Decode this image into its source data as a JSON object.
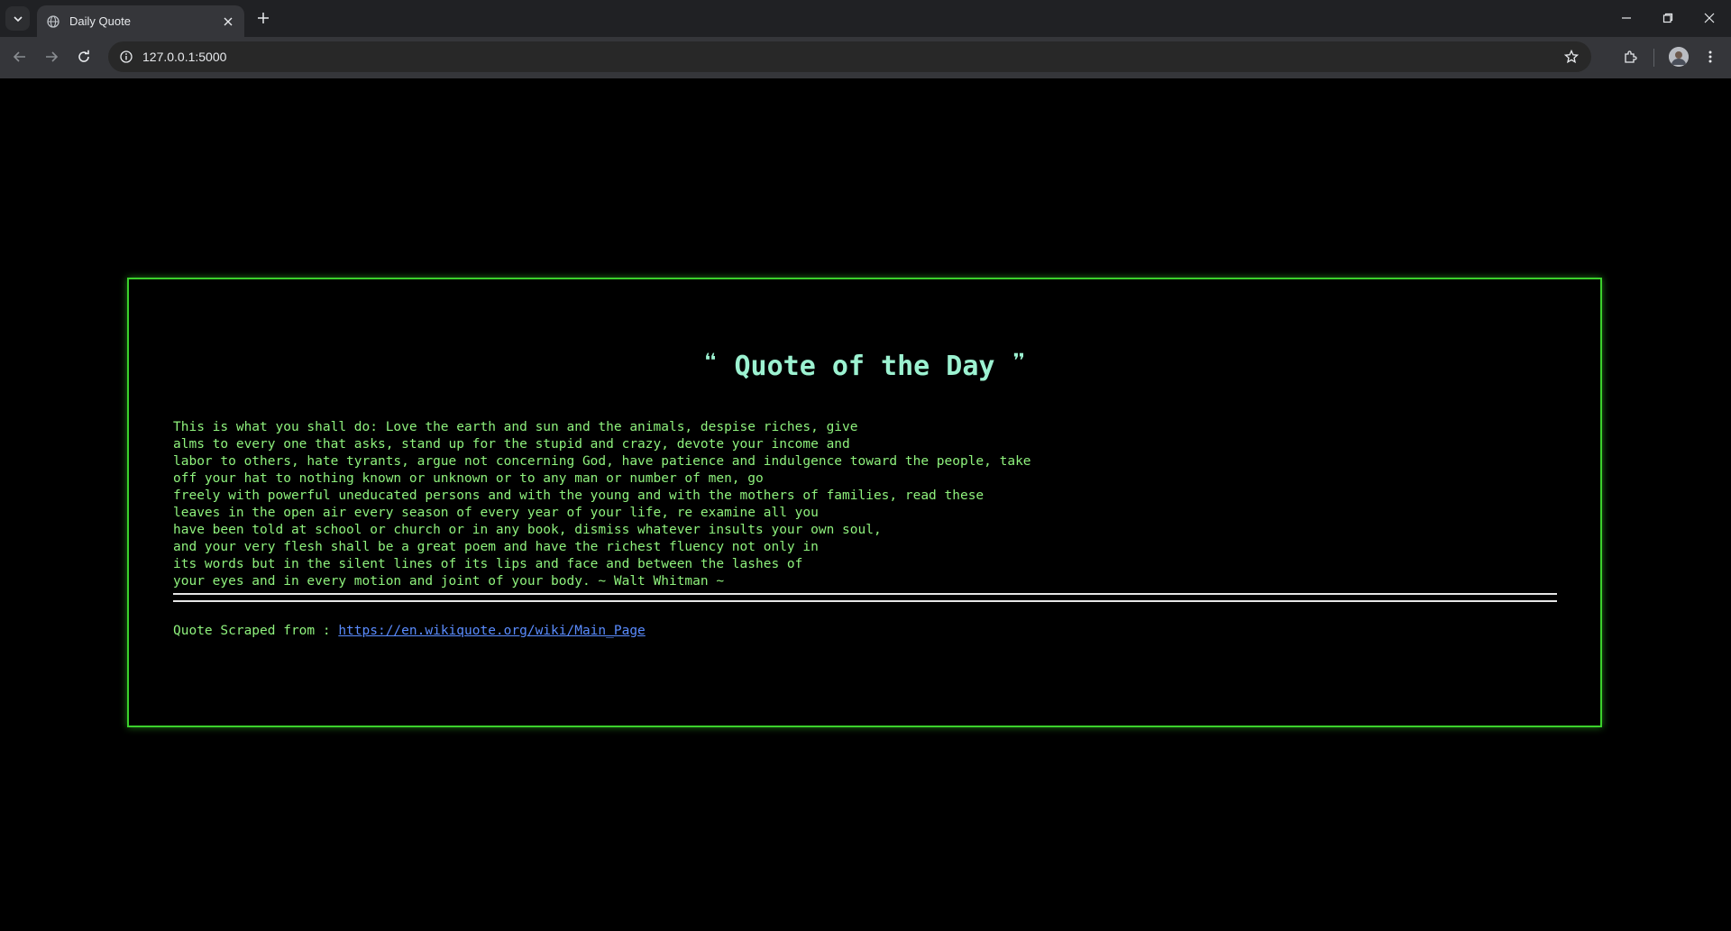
{
  "browser": {
    "tab_title": "Daily Quote",
    "url": "127.0.0.1:5000",
    "icons": [
      "tab-search-icon",
      "globe-icon",
      "close-icon",
      "plus-icon",
      "minimize-icon",
      "restore-icon",
      "close-window-icon",
      "back-icon",
      "forward-icon",
      "reload-icon",
      "site-info-icon",
      "star-icon",
      "extensions-icon",
      "profile-avatar",
      "more-vert-icon"
    ]
  },
  "page": {
    "heading_open": "❝",
    "heading": "Quote of the Day",
    "heading_close": "❞",
    "quote_lines": [
      "This is what you shall do: Love the earth and sun and the animals, despise riches, give",
      "alms to every one that asks, stand up for the stupid and crazy, devote your income and",
      "labor to others, hate tyrants, argue not concerning God, have patience and indulgence toward the people, take",
      "off your hat to nothing known or unknown or to any man or number of men, go",
      "freely with powerful uneducated persons and with the young and with the mothers of families, read these",
      "leaves in the open air every season of every year of your life, re examine all you",
      "have been told at school or church or in any book, dismiss whatever insults your own soul,",
      "and your very flesh shall be a great poem and have the richest fluency not only in",
      "its words but in the silent lines of its lips and face and between the lashes of",
      "your eyes and in every motion and joint of your body. ~ Walt Whitman ~"
    ],
    "source_label": "Quote Scraped from : ",
    "source_link": "https://en.wikiquote.org/wiki/Main_Page"
  },
  "colors": {
    "background": "#000000",
    "border": "#3bd12c",
    "heading": "#9cf2d1",
    "text": "#8ff27d",
    "link": "#5a8cff"
  }
}
